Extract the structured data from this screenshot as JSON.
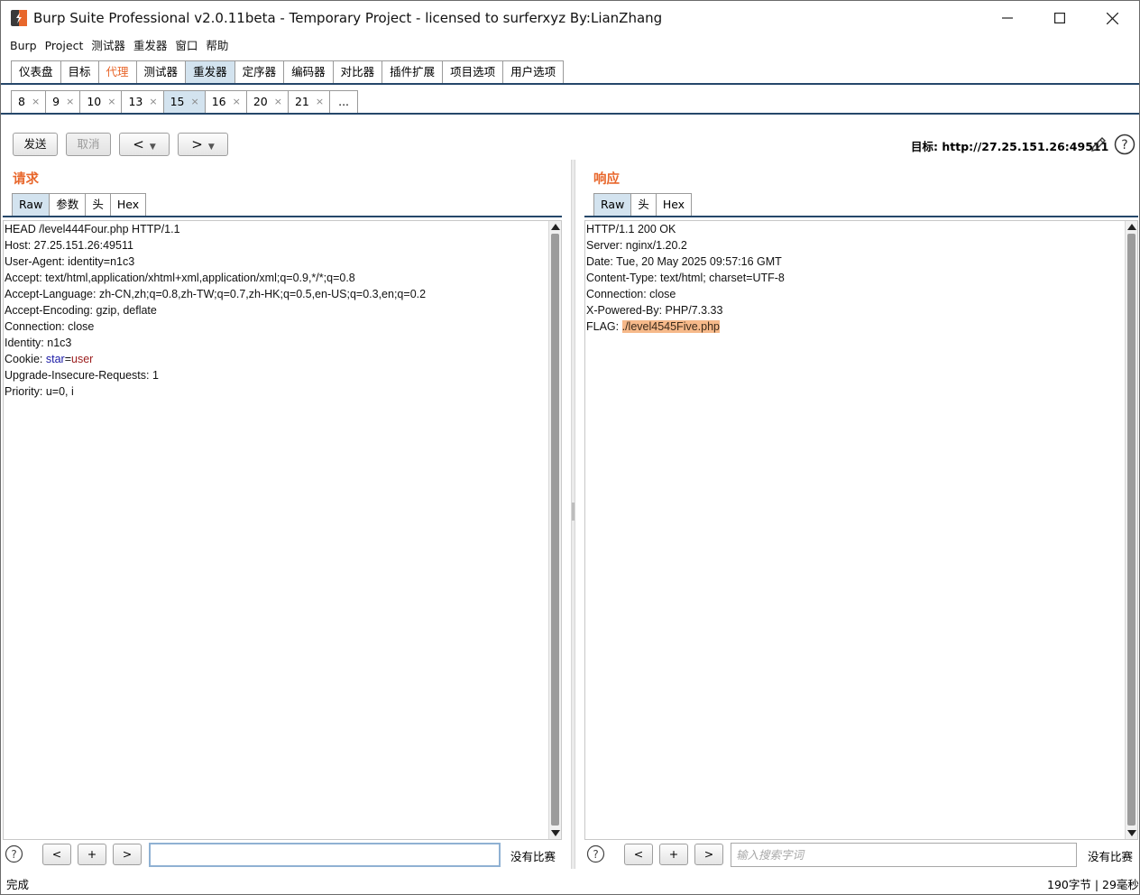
{
  "window": {
    "title": "Burp Suite Professional v2.0.11beta - Temporary Project - licensed to surferxyz By:LianZhang"
  },
  "menu": [
    "Burp",
    "Project",
    "测试器",
    "重发器",
    "窗口",
    "帮助"
  ],
  "main_tabs": [
    {
      "label": "仪表盘"
    },
    {
      "label": "目标"
    },
    {
      "label": "代理"
    },
    {
      "label": "测试器"
    },
    {
      "label": "重发器"
    },
    {
      "label": "定序器"
    },
    {
      "label": "编码器"
    },
    {
      "label": "对比器"
    },
    {
      "label": "插件扩展"
    },
    {
      "label": "项目选项"
    },
    {
      "label": "用户选项"
    }
  ],
  "repeater_tabs": [
    {
      "label": "8",
      "close": "×"
    },
    {
      "label": "9",
      "close": "×"
    },
    {
      "label": "10",
      "close": "×"
    },
    {
      "label": "13",
      "close": "×"
    },
    {
      "label": "15",
      "close": "×"
    },
    {
      "label": "16",
      "close": "×"
    },
    {
      "label": "20",
      "close": "×"
    },
    {
      "label": "21",
      "close": "×"
    },
    {
      "label": "...",
      "close": ""
    }
  ],
  "toolbar": {
    "send": "发送",
    "cancel": "取消",
    "back": "<",
    "forward": ">",
    "dropdown": "▼",
    "target": "目标: http://27.25.151.26:49511"
  },
  "request": {
    "title": "请求",
    "tabs": [
      "Raw",
      "参数",
      "头",
      "Hex"
    ],
    "lines": [
      "HEAD /level444Four.php HTTP/1.1",
      "Host: 27.25.151.26:49511",
      "User-Agent: identity=n1c3",
      "Accept: text/html,application/xhtml+xml,application/xml;q=0.9,*/*;q=0.8",
      "Accept-Language: zh-CN,zh;q=0.8,zh-TW;q=0.7,zh-HK;q=0.5,en-US;q=0.3,en;q=0.2",
      "Accept-Encoding: gzip, deflate",
      "Connection: close",
      "Identity: n1c3"
    ],
    "cookie_prefix": "Cookie: ",
    "cookie_name": "star",
    "cookie_eq": "=",
    "cookie_value": "user",
    "lines_after": [
      "Upgrade-Insecure-Requests: 1",
      "Priority: u=0, i"
    ],
    "search_value": "",
    "no_match": "没有比赛"
  },
  "response": {
    "title": "响应",
    "tabs": [
      "Raw",
      "头",
      "Hex"
    ],
    "lines": [
      "HTTP/1.1 200 OK",
      "Server: nginx/1.20.2",
      "Date: Tue, 20 May 2025 09:57:16 GMT",
      "Content-Type: text/html; charset=UTF-8",
      "Connection: close",
      "X-Powered-By: PHP/7.3.33"
    ],
    "flag_prefix": "FLAG: ",
    "flag_value": "./level4545Five.php",
    "search_placeholder": "输入搜索字词",
    "no_match": "没有比赛"
  },
  "search_buttons": {
    "prev": "<",
    "add": "+",
    "next": ">"
  },
  "status": {
    "left": "完成",
    "right": "190字节 | 29毫秒"
  },
  "colors": {
    "accent_orange": "#e8672c",
    "active_tab": "#d3e3ef",
    "tab_underline": "#25476a",
    "highlight": "#f6b98a"
  },
  "icons": {
    "logo": "burp-logo-icon",
    "edit": "pencil-icon",
    "help": "help-icon"
  }
}
